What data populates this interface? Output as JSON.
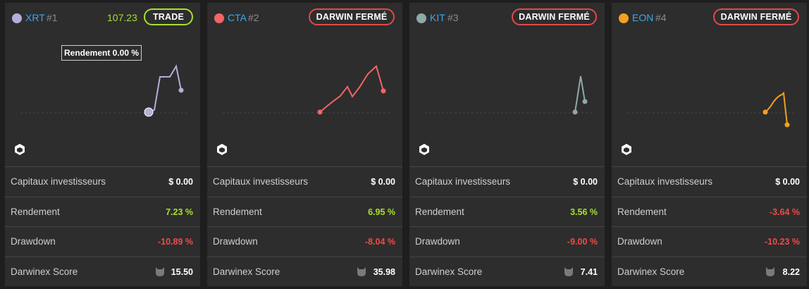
{
  "labels": {
    "capital": "Capitaux investisseurs",
    "return": "Rendement",
    "drawdown": "Drawdown",
    "score": "Darwinex Score"
  },
  "cards": [
    {
      "ticker": "XRT",
      "rank": "#1",
      "price": "107.23",
      "button": "TRADE",
      "dot_color": "#b4aedb",
      "line_color": "#b4aedb",
      "tooltip": "Rendement 0.00 %",
      "capital": "$ 0.00",
      "return": "7.23 %",
      "drawdown": "-10.89 %",
      "score": "15.50"
    },
    {
      "ticker": "CTA",
      "rank": "#2",
      "button": "DARWIN FERMÉ",
      "dot_color": "#f26565",
      "line_color": "#f26565",
      "capital": "$ 0.00",
      "return": "6.95 %",
      "drawdown": "-8.04 %",
      "score": "35.98"
    },
    {
      "ticker": "KIT",
      "rank": "#3",
      "button": "DARWIN FERMÉ",
      "dot_color": "#8fa9a7",
      "line_color": "#8fa9a7",
      "capital": "$ 0.00",
      "return": "3.56 %",
      "drawdown": "-9.00 %",
      "score": "7.41"
    },
    {
      "ticker": "EON",
      "rank": "#4",
      "button": "DARWIN FERMÉ",
      "dot_color": "#f2a01f",
      "line_color": "#f2a01f",
      "capital": "$ 0.00",
      "return": "-3.64 %",
      "drawdown": "-10.23 %",
      "score": "8.22"
    }
  ]
}
